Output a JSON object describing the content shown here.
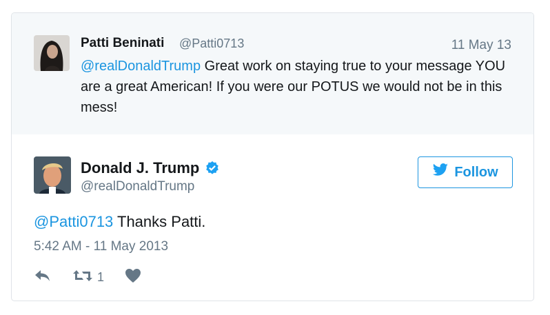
{
  "parent_tweet": {
    "author_name": "Patti Beninati",
    "author_handle": "@Patti0713",
    "date": "11 May 13",
    "mention": "@realDonaldTrump",
    "text": " Great work on staying true to your message YOU are a great American! If you were our POTUS we would not be in this mess!"
  },
  "tweet": {
    "author_name": "Donald J. Trump",
    "author_handle": "@realDonaldTrump",
    "verified_icon": "verified-badge-icon",
    "follow_label": "Follow",
    "mention": "@Patti0713",
    "text": " Thanks Patti.",
    "timestamp": "5:42 AM - 11 May 2013",
    "retweet_count": "1"
  },
  "colors": {
    "link": "#1b95e0",
    "muted": "#657786",
    "parent_bg": "#f5f8fa",
    "border": "#dfe3e8"
  }
}
